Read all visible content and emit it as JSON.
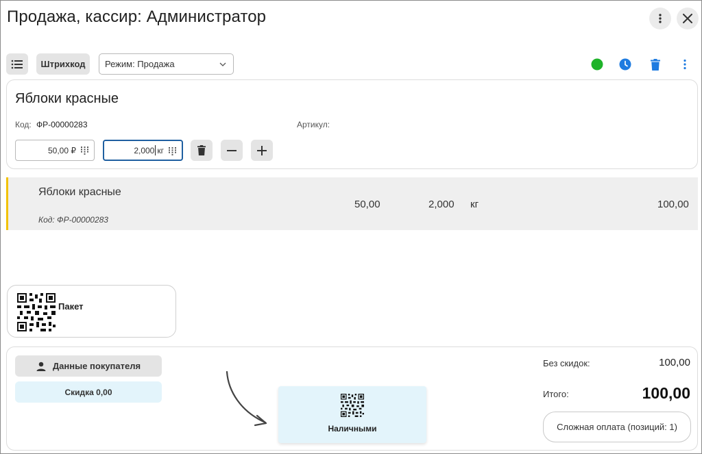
{
  "window": {
    "title": "Продажа, кассир: Администратор",
    "more_icon": "vertical-dots-icon",
    "close_icon": "close-icon"
  },
  "toolbar": {
    "list_icon": "list-icon",
    "barcode_label": "Штрихкод",
    "mode_select": "Режим: Продажа",
    "status_color": "#1fb32a",
    "clock_color": "#1e7be0",
    "trash_color": "#1e7be0",
    "more_color": "#1e7be0"
  },
  "product": {
    "name": "Яблоки красные",
    "code_label": "Код:",
    "code_value": "ФР-00000283",
    "article_label": "Артикул:",
    "price_value": "50,00 ₽",
    "qty_value": "2,000",
    "qty_unit": "кг"
  },
  "line_items": [
    {
      "name": "Яблоки красные",
      "code": "Код: ФР-00000283",
      "price": "50,00",
      "qty": "2,000",
      "unit": "кг",
      "sum": "100,00"
    }
  ],
  "quick_items": [
    {
      "label": "Пакет"
    }
  ],
  "payment": {
    "customer_btn": "Данные покупателя",
    "discount_btn": "Скидка 0,00",
    "cash_btn": "Наличными",
    "no_discount_label": "Без скидок:",
    "no_discount_value": "100,00",
    "total_label": "Итого:",
    "total_value": "100,00",
    "complex_btn": "Сложная оплата (позиций: 1)"
  }
}
